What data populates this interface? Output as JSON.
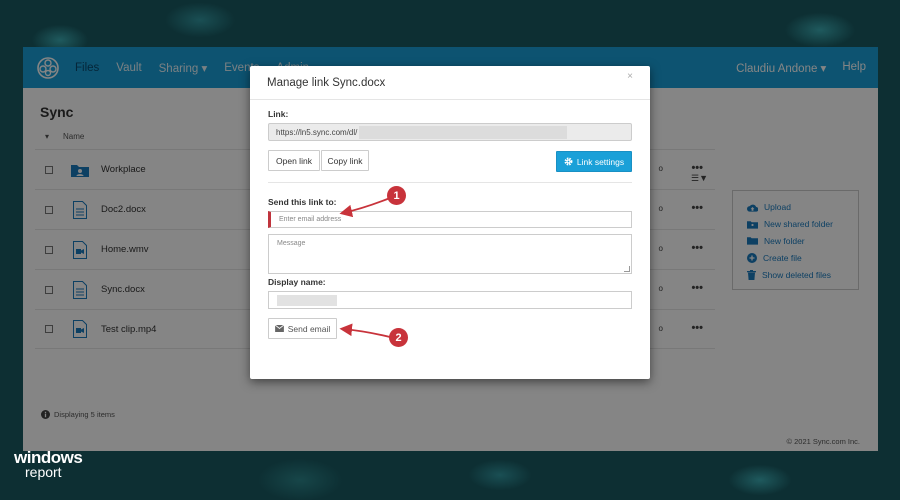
{
  "navbar": {
    "items": [
      "Files",
      "Vault",
      "Sharing ▾",
      "Events",
      "Admin"
    ],
    "user": "Claudiu Andone ▾",
    "help": "Help"
  },
  "page": {
    "title": "Sync",
    "name_column": "Name",
    "files": [
      {
        "name": "Workplace",
        "icon": "folder-user-icon"
      },
      {
        "name": "Doc2.docx",
        "icon": "document-icon"
      },
      {
        "name": "Home.wmv",
        "icon": "video-file-icon"
      },
      {
        "name": "Sync.docx",
        "icon": "document-icon"
      },
      {
        "name": "Test clip.mp4",
        "icon": "video-file-icon"
      }
    ],
    "row_menu": "•••",
    "displaying": "Displaying 5 items",
    "footer": "© 2021 Sync.com Inc."
  },
  "side_panel": {
    "items": [
      {
        "label": "Upload",
        "icon": "cloud-upload-icon"
      },
      {
        "label": "New shared folder",
        "icon": "shared-folder-icon"
      },
      {
        "label": "New folder",
        "icon": "folder-icon"
      },
      {
        "label": "Create file",
        "icon": "plus-circle-icon"
      },
      {
        "label": "Show deleted files",
        "icon": "trash-icon"
      }
    ]
  },
  "modal": {
    "title": "Manage link Sync.docx",
    "close": "×",
    "link_label": "Link:",
    "link_value": "https://ln5.sync.com/dl/",
    "open_link": "Open link",
    "copy_link": "Copy link",
    "link_settings": "Link settings",
    "send_label": "Send this link to:",
    "email_placeholder": "Enter email address",
    "message_placeholder": "Message",
    "display_name_label": "Display name:",
    "send_email": "Send email"
  },
  "annotations": {
    "one": "1",
    "two": "2"
  },
  "watermark": {
    "line1": "windows",
    "line2": "report"
  },
  "colors": {
    "accent": "#1aa0d8",
    "annotation": "#c8333b"
  }
}
